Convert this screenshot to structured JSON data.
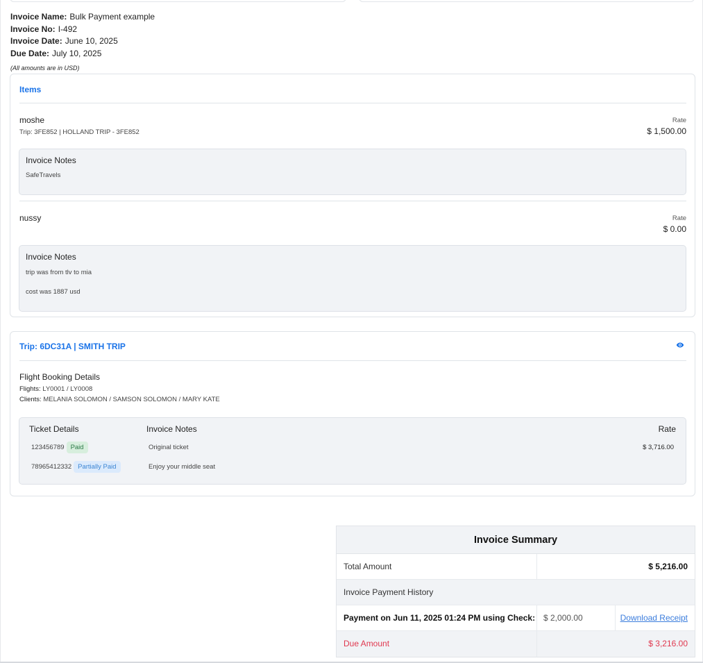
{
  "invoice": {
    "name_label": "Invoice Name:",
    "name": "Bulk Payment example",
    "no_label": "Invoice No:",
    "no": "I-492",
    "date_label": "Invoice Date:",
    "date": "June 10, 2025",
    "due_label": "Due Date:",
    "due": "July 10, 2025",
    "currency_note": "(All amounts are in USD)"
  },
  "items_card": {
    "title": "Items",
    "items": [
      {
        "name": "moshe",
        "sub": "Trip: 3FE852 | HOLLAND TRIP - 3FE852",
        "rate_label": "Rate",
        "rate": "$ 1,500.00",
        "notes_title": "Invoice Notes",
        "notes": [
          "SafeTravels"
        ]
      },
      {
        "name": "nussy",
        "sub": "",
        "rate_label": "Rate",
        "rate": "$ 0.00",
        "notes_title": "Invoice Notes",
        "notes": [
          "trip was from tlv to mia",
          "cost was 1887 usd"
        ]
      }
    ]
  },
  "trip_card": {
    "title": "Trip: 6DC31A | SMITH TRIP",
    "flight_title": "Flight Booking Details",
    "flights_label": "Flights:",
    "flights": "LY0001 / LY0008",
    "clients_label": "Clients:",
    "clients": "MELANIA SOLOMON / SAMSON SOLOMON / MARY KATE",
    "headers": {
      "ticket": "Ticket Details",
      "notes": "Invoice Notes",
      "rate": "Rate"
    },
    "tickets": [
      {
        "number": "123456789",
        "status": "Paid",
        "note": "Original ticket",
        "rate": "$ 3,716.00"
      },
      {
        "number": "78965412332",
        "status": "Partially Paid",
        "note": "Enjoy your middle seat",
        "rate": ""
      }
    ]
  },
  "summary": {
    "title": "Invoice Summary",
    "total_label": "Total Amount",
    "total": "$ 5,216.00",
    "history_label": "Invoice Payment History",
    "payment_label": "Payment on Jun 11, 2025 01:24 PM using Check:",
    "payment_amount": "$ 2,000.00",
    "download_label": "Download Receipt",
    "due_label": "Due Amount",
    "due": "$ 3,216.00"
  },
  "colors": {
    "accent": "#1a73e8",
    "due": "#e0384f",
    "paid_bg": "#d7eedd",
    "partial_bg": "#dbeafc"
  },
  "icons": {
    "trip_view": "eye-icon"
  }
}
